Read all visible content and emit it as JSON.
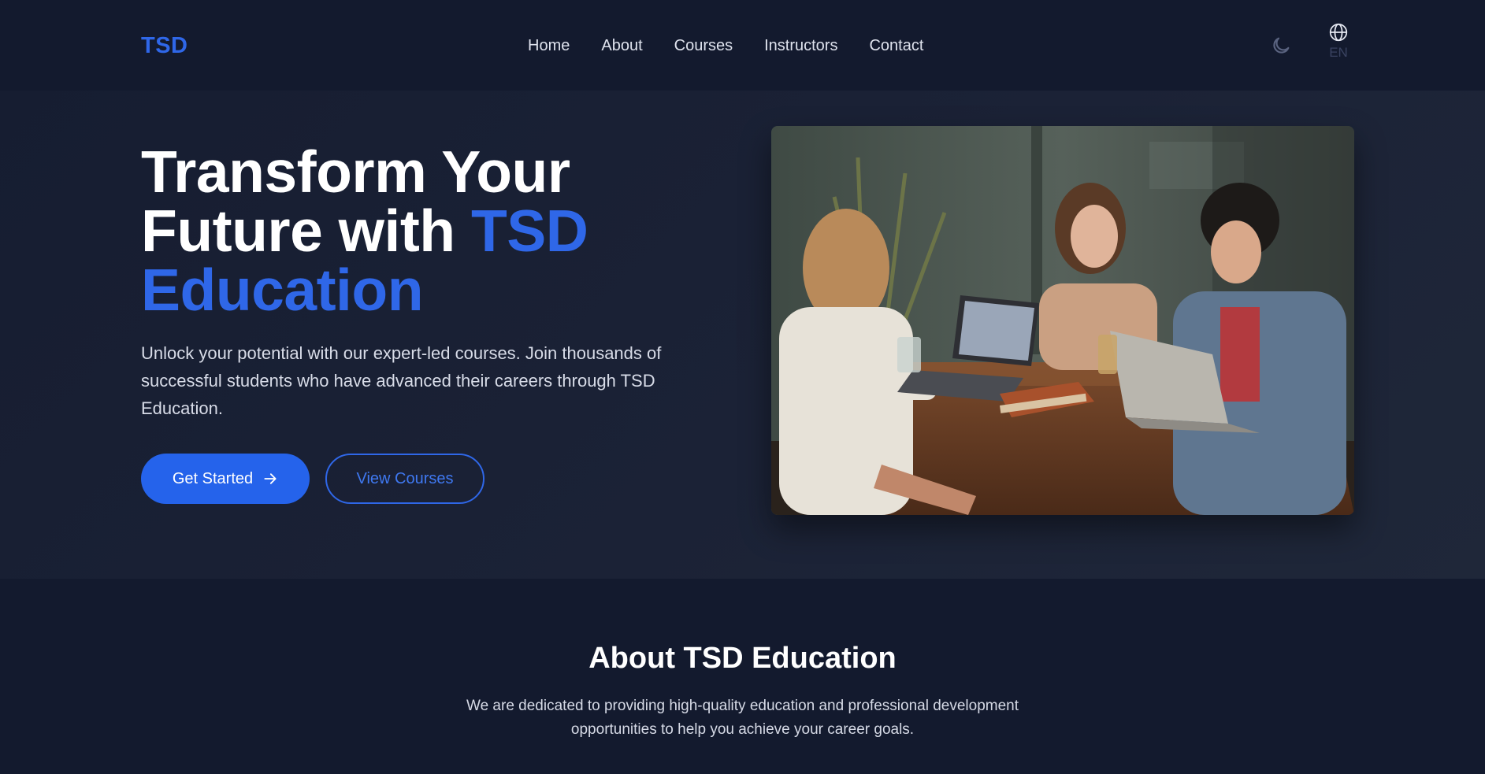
{
  "nav": {
    "logo": "TSD",
    "links": [
      "Home",
      "About",
      "Courses",
      "Instructors",
      "Contact"
    ],
    "theme_icon": "moon-icon",
    "lang_icon": "globe-icon",
    "lang_code": "EN"
  },
  "hero": {
    "title_line1": "Transform Your",
    "title_line2_plain": "Future with ",
    "title_line2_accent": "TSD",
    "title_line3_accent": "Education",
    "subtitle": "Unlock your potential with our expert-led courses. Join thousands of successful students who have advanced their careers through TSD Education.",
    "primary_button": "Get Started",
    "primary_icon": "arrow-right-icon",
    "secondary_button": "View Courses",
    "image_icon": "students-at-table-photo"
  },
  "about": {
    "title": "About TSD Education",
    "text": "We are dedicated to providing high-quality education and professional development opportunities to help you achieve your career goals."
  },
  "colors": {
    "background": "#131a2e",
    "accent": "#2f67e8",
    "button": "#2563eb"
  }
}
